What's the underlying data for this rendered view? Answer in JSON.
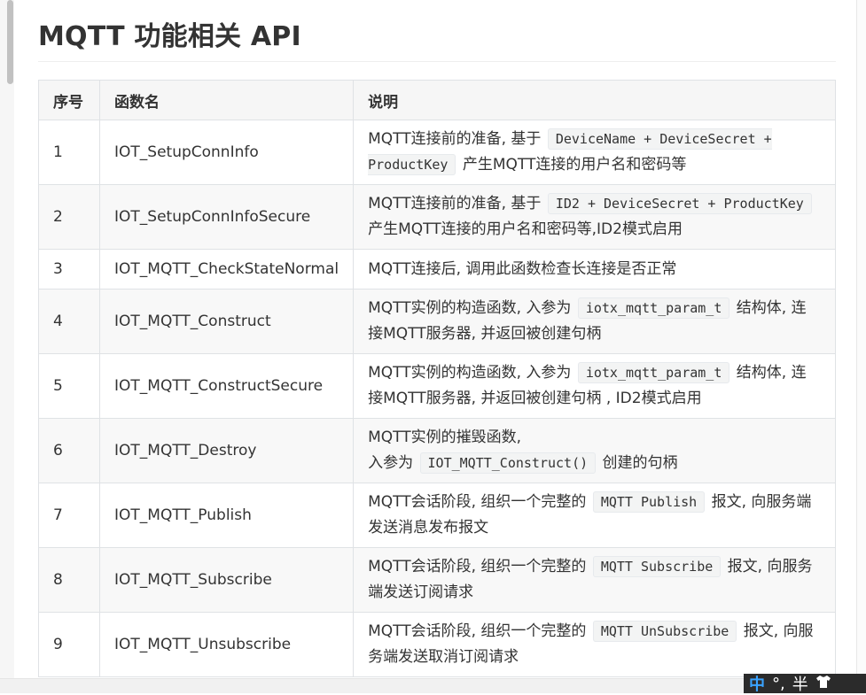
{
  "section": {
    "title": "MQTT 功能相关 API"
  },
  "table": {
    "headers": [
      "序号",
      "函数名",
      "说明"
    ],
    "rows": [
      {
        "no": "1",
        "fn": "IOT_SetupConnInfo",
        "desc": [
          {
            "t": "text",
            "v": "MQTT连接前的准备, 基于 "
          },
          {
            "t": "code",
            "v": "DeviceName + DeviceSecret + ProductKey"
          },
          {
            "t": "text",
            "v": " 产生MQTT连接的用户名和密码等"
          }
        ]
      },
      {
        "no": "2",
        "fn": "IOT_SetupConnInfoSecure",
        "desc": [
          {
            "t": "text",
            "v": "MQTT连接前的准备, 基于 "
          },
          {
            "t": "code",
            "v": "ID2 + DeviceSecret + ProductKey"
          },
          {
            "t": "text",
            "v": " 产生MQTT连接的用户名和密码等,ID2模式启用"
          }
        ]
      },
      {
        "no": "3",
        "fn": "IOT_MQTT_CheckStateNormal",
        "desc": [
          {
            "t": "text",
            "v": "MQTT连接后, 调用此函数检查长连接是否正常"
          }
        ]
      },
      {
        "no": "4",
        "fn": "IOT_MQTT_Construct",
        "desc": [
          {
            "t": "text",
            "v": "MQTT实例的构造函数, 入参为 "
          },
          {
            "t": "code",
            "v": "iotx_mqtt_param_t"
          },
          {
            "t": "text",
            "v": " 结构体, 连接MQTT服务器, 并返回被创建句柄"
          }
        ]
      },
      {
        "no": "5",
        "fn": "IOT_MQTT_ConstructSecure",
        "desc": [
          {
            "t": "text",
            "v": "MQTT实例的构造函数, 入参为 "
          },
          {
            "t": "code",
            "v": "iotx_mqtt_param_t"
          },
          {
            "t": "text",
            "v": " 结构体, 连接MQTT服务器, 并返回被创建句柄 , ID2模式启用"
          }
        ]
      },
      {
        "no": "6",
        "fn": "IOT_MQTT_Destroy",
        "desc": [
          {
            "t": "text",
            "v": "MQTT实例的摧毁函数, "
          },
          {
            "t": "br"
          },
          {
            "t": "text",
            "v": "入参为 "
          },
          {
            "t": "code",
            "v": "IOT_MQTT_Construct()"
          },
          {
            "t": "text",
            "v": " 创建的句柄"
          }
        ]
      },
      {
        "no": "7",
        "fn": "IOT_MQTT_Publish",
        "desc": [
          {
            "t": "text",
            "v": "MQTT会话阶段, 组织一个完整的 "
          },
          {
            "t": "code",
            "v": "MQTT Publish"
          },
          {
            "t": "text",
            "v": " 报文, 向服务端发送消息发布报文"
          }
        ]
      },
      {
        "no": "8",
        "fn": "IOT_MQTT_Subscribe",
        "desc": [
          {
            "t": "text",
            "v": "MQTT会话阶段, 组织一个完整的 "
          },
          {
            "t": "code",
            "v": "MQTT Subscribe"
          },
          {
            "t": "text",
            "v": " 报文, 向服务端发送订阅请求"
          }
        ]
      },
      {
        "no": "9",
        "fn": "IOT_MQTT_Unsubscribe",
        "desc": [
          {
            "t": "text",
            "v": "MQTT会话阶段, 组织一个完整的 "
          },
          {
            "t": "code",
            "v": "MQTT UnSubscribe"
          },
          {
            "t": "text",
            "v": " 报文, 向服务端发送取消订阅请求"
          }
        ]
      }
    ]
  },
  "ime": {
    "mode": "中",
    "punct": "°,",
    "width": "半",
    "icon": "shirt-icon"
  }
}
